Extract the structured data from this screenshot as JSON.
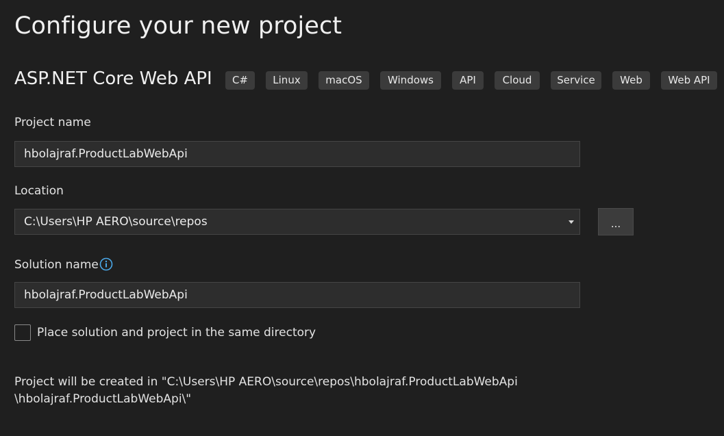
{
  "header": {
    "title": "Configure your new project"
  },
  "template": {
    "name": "ASP.NET Core Web API",
    "tags": [
      "C#",
      "Linux",
      "macOS",
      "Windows",
      "API",
      "Cloud",
      "Service",
      "Web",
      "Web API"
    ]
  },
  "form": {
    "project_name": {
      "label": "Project name",
      "value": "hbolajraf.ProductLabWebApi"
    },
    "location": {
      "label": "Location",
      "value": "C:\\Users\\HP AERO\\source\\repos",
      "browse_label": "..."
    },
    "solution_name": {
      "label": "Solution name",
      "value": "hbolajraf.ProductLabWebApi",
      "info_icon": "info-circle-icon"
    },
    "same_directory": {
      "label": "Place solution and project in the same directory",
      "checked": false
    }
  },
  "footer": {
    "path_line1": "Project will be created in \"C:\\Users\\HP AERO\\source\\repos\\hbolajraf.ProductLabWebApi",
    "path_line2": "\\hbolajraf.ProductLabWebApi\\\""
  },
  "colors": {
    "background": "#1f1f1f",
    "tag_background": "#3b3b3b",
    "input_background": "#2d2d2d",
    "info_icon": "#4aa8e8"
  }
}
